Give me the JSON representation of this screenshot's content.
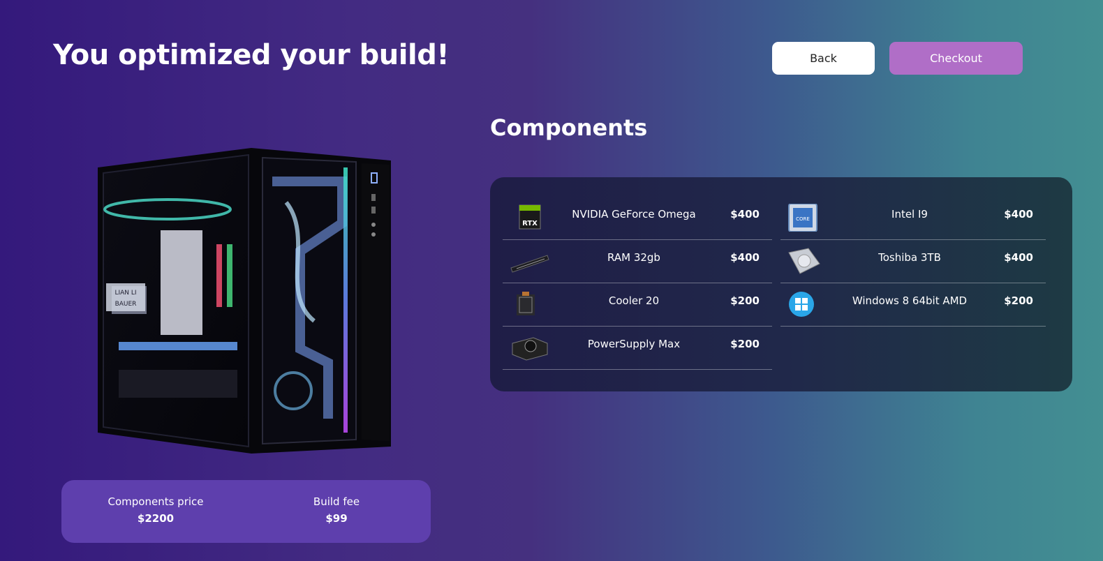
{
  "header": {
    "title": "You optimized your build!",
    "back_label": "Back",
    "checkout_label": "Checkout"
  },
  "components": {
    "heading": "Components",
    "left": [
      {
        "name": "NVIDIA GeForce Omega",
        "price": "$400",
        "icon": "gpu-icon"
      },
      {
        "name": "RAM 32gb",
        "price": "$400",
        "icon": "ram-icon"
      },
      {
        "name": "Cooler 20",
        "price": "$200",
        "icon": "cooler-icon"
      },
      {
        "name": "PowerSupply Max",
        "price": "$200",
        "icon": "power-supply-icon"
      }
    ],
    "right": [
      {
        "name": "Intel I9",
        "price": "$400",
        "icon": "cpu-icon"
      },
      {
        "name": "Toshiba 3TB",
        "price": "$400",
        "icon": "hdd-icon"
      },
      {
        "name": "Windows 8 64bit AMD",
        "price": "$200",
        "icon": "windows-icon"
      }
    ]
  },
  "summary": {
    "components_price_label": "Components price",
    "components_price_value": "$2200",
    "build_fee_label": "Build fee",
    "build_fee_value": "$99"
  },
  "colors": {
    "checkout_button": "#b06ec7",
    "summary_box": "#5e3fad",
    "panel_bg": "#1f2848"
  }
}
